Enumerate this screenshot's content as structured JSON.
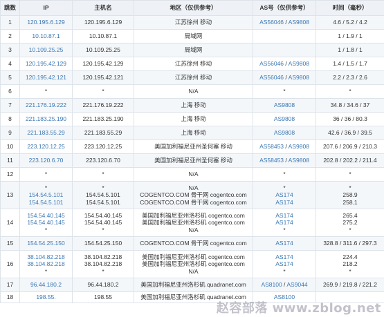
{
  "headers": {
    "hop": "跳数",
    "ip": "IP",
    "host": "主机名",
    "region": "地区（仅供参考）",
    "as": "AS号（仅供参考）",
    "time": "时间（毫秒）"
  },
  "rows": [
    {
      "hop": "1",
      "ip": [
        "120.195.6.129"
      ],
      "host": [
        "120.195.6.129"
      ],
      "region": [
        "江苏徐州 移动"
      ],
      "as": [
        [
          "AS56046",
          "AS9808"
        ]
      ],
      "time": [
        "4.6 / 5.2 / 4.2"
      ]
    },
    {
      "hop": "2",
      "ip": [
        "10.10.87.1"
      ],
      "host": [
        "10.10.87.1"
      ],
      "region": [
        "局域网"
      ],
      "as": [
        []
      ],
      "time": [
        "1 / 1.9 / 1"
      ]
    },
    {
      "hop": "3",
      "ip": [
        "10.109.25.25"
      ],
      "host": [
        "10.109.25.25"
      ],
      "region": [
        "局域网"
      ],
      "as": [
        []
      ],
      "time": [
        "1 / 1.8 / 1"
      ]
    },
    {
      "hop": "4",
      "ip": [
        "120.195.42.129"
      ],
      "host": [
        "120.195.42.129"
      ],
      "region": [
        "江苏徐州 移动"
      ],
      "as": [
        [
          "AS56046",
          "AS9808"
        ]
      ],
      "time": [
        "1.4 / 1.5 / 1.7"
      ]
    },
    {
      "hop": "5",
      "ip": [
        "120.195.42.121"
      ],
      "host": [
        "120.195.42.121"
      ],
      "region": [
        "江苏徐州 移动"
      ],
      "as": [
        [
          "AS56046",
          "AS9808"
        ]
      ],
      "time": [
        "2.2 / 2.3 / 2.6"
      ]
    },
    {
      "hop": "6",
      "ip": [
        "*"
      ],
      "host": [
        "*"
      ],
      "region": [
        "N/A"
      ],
      "as": [
        [
          "*"
        ]
      ],
      "time": [
        "*"
      ]
    },
    {
      "hop": "7",
      "ip": [
        "221.176.19.222"
      ],
      "host": [
        "221.176.19.222"
      ],
      "region": [
        "上海 移动"
      ],
      "as": [
        [
          "AS9808"
        ]
      ],
      "time": [
        "34.8 / 34.6 / 37"
      ]
    },
    {
      "hop": "8",
      "ip": [
        "221.183.25.190"
      ],
      "host": [
        "221.183.25.190"
      ],
      "region": [
        "上海 移动"
      ],
      "as": [
        [
          "AS9808"
        ]
      ],
      "time": [
        "36 / 36 / 80.3"
      ]
    },
    {
      "hop": "9",
      "ip": [
        "221.183.55.29"
      ],
      "host": [
        "221.183.55.29"
      ],
      "region": [
        "上海 移动"
      ],
      "as": [
        [
          "AS9808"
        ]
      ],
      "time": [
        "42.6 / 36.9 / 39.5"
      ]
    },
    {
      "hop": "10",
      "ip": [
        "223.120.12.25"
      ],
      "host": [
        "223.120.12.25"
      ],
      "region": [
        "美国加利福尼亚州圣何塞 移动"
      ],
      "as": [
        [
          "AS58453",
          "AS9808"
        ]
      ],
      "time": [
        "207.6 / 206.9 / 210.3"
      ]
    },
    {
      "hop": "11",
      "ip": [
        "223.120.6.70"
      ],
      "host": [
        "223.120.6.70"
      ],
      "region": [
        "美国加利福尼亚州圣何塞 移动"
      ],
      "as": [
        [
          "AS58453",
          "AS9808"
        ]
      ],
      "time": [
        "202.8 / 202.2 / 211.4"
      ]
    },
    {
      "hop": "12",
      "ip": [
        "*"
      ],
      "host": [
        "*"
      ],
      "region": [
        "N/A"
      ],
      "as": [
        [
          "*"
        ]
      ],
      "time": [
        "*"
      ]
    },
    {
      "hop": "13",
      "ip": [
        "*",
        "154.54.5.101",
        "154.54.5.101"
      ],
      "host": [
        "*",
        "154.54.5.101",
        "154.54.5.101"
      ],
      "region": [
        "N/A",
        "COGENTCO.COM 骨干网 cogentco.com",
        "COGENTCO.COM 骨干网 cogentco.com"
      ],
      "as": [
        [
          "*"
        ],
        [
          "AS174"
        ],
        [
          "AS174"
        ]
      ],
      "time": [
        "*",
        "258.9",
        "258.1"
      ]
    },
    {
      "hop": "14",
      "ip": [
        "154.54.40.145",
        "154.54.40.145",
        "*"
      ],
      "host": [
        "154.54.40.145",
        "154.54.40.145",
        "*"
      ],
      "region": [
        "美国加利福尼亚州洛杉矶 cogentco.com",
        "美国加利福尼亚州洛杉矶 cogentco.com",
        "N/A"
      ],
      "as": [
        [
          "AS174"
        ],
        [
          "AS174"
        ],
        [
          "*"
        ]
      ],
      "time": [
        "265.4",
        "275.2",
        "*"
      ]
    },
    {
      "hop": "15",
      "ip": [
        "154.54.25.150"
      ],
      "host": [
        "154.54.25.150"
      ],
      "region": [
        "COGENTCO.COM 骨干网 cogentco.com"
      ],
      "as": [
        [
          "AS174"
        ]
      ],
      "time": [
        "328.8 / 311.6 / 297.3"
      ]
    },
    {
      "hop": "16",
      "ip": [
        "38.104.82.218",
        "38.104.82.218",
        "*"
      ],
      "host": [
        "38.104.82.218",
        "38.104.82.218",
        "*"
      ],
      "region": [
        "美国加利福尼亚州洛杉矶 cogentco.com",
        "美国加利福尼亚州洛杉矶 cogentco.com",
        "N/A"
      ],
      "as": [
        [
          "AS174"
        ],
        [
          "AS174"
        ],
        [
          "*"
        ]
      ],
      "time": [
        "224.4",
        "218.2",
        "*"
      ]
    },
    {
      "hop": "17",
      "ip": [
        "96.44.180.2"
      ],
      "host": [
        "96.44.180.2"
      ],
      "region": [
        "美国加利福尼亚州洛杉矶 quadranet.com"
      ],
      "as": [
        [
          "AS8100",
          "AS9044"
        ]
      ],
      "time": [
        "269.9 / 219.8 / 221.2"
      ]
    },
    {
      "hop": "18",
      "ip": [
        "198.55."
      ],
      "host": [
        "198.55"
      ],
      "region": [
        "美国加利福尼亚州洛杉矶 quadranet.com"
      ],
      "as": [
        [
          "AS8100"
        ]
      ],
      "time": [
        ""
      ]
    }
  ],
  "watermark": "赵容部落 www.zblog.net",
  "colors": {
    "link": "#3a77b3",
    "header_bg": "#eef2f6",
    "odd_row_bg": "#f4f7fa",
    "border": "#dde3ea"
  }
}
